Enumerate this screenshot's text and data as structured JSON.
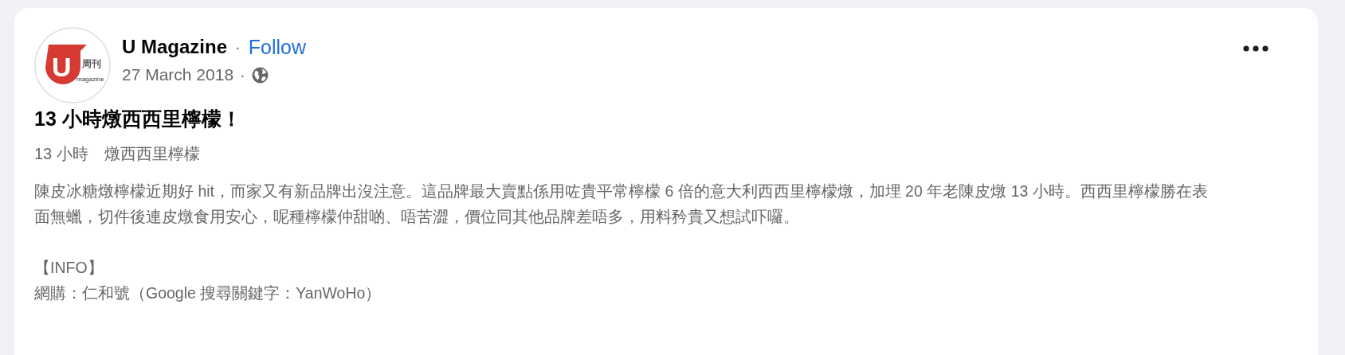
{
  "post": {
    "author": "U Magazine",
    "separator": "·",
    "follow": "Follow",
    "date": "27 March 2018",
    "date_separator": "·",
    "avatar_logo": {
      "mark": "U",
      "cn": "周刊",
      "en": "magazine"
    },
    "title": "13 小時燉西西里檸檬！",
    "subtitle": "13 小時　燉西西里檸檬",
    "body": "陳皮冰糖燉檸檬近期好 hit，而家又有新品牌出沒注意。這品牌最大賣點係用咗貴平常檸檬 6 倍的意大利西西里檸檬燉，加埋 20 年老陳皮燉 13 小時。西西里檸檬勝在表面無蠟，切件後連皮燉食用安心，呢種檸檬仲甜啲、唔苦澀，價位同其他品牌差唔多，用料矜貴又想試吓囉。",
    "info_heading": "【INFO】",
    "info_line": "網購：仁和號（Google 搜尋關鍵字：YanWoHo）"
  }
}
